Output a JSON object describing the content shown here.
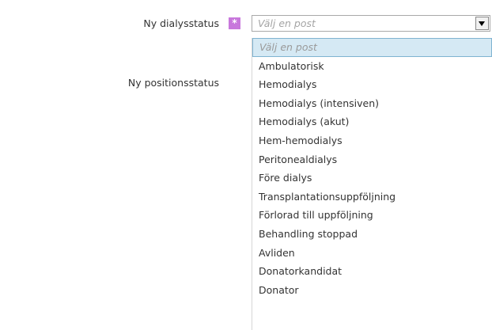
{
  "form": {
    "dialysis_status_label": "Ny dialysstatus",
    "position_status_label": "Ny positionsstatus",
    "required_marker": "*"
  },
  "dropdown": {
    "placeholder": "Välj en post",
    "selected_value": "Välj en post",
    "options": [
      "Välj en post",
      "Ambulatorisk",
      "Hemodialys",
      "Hemodialys (intensiven)",
      "Hemodialys (akut)",
      "Hem-hemodialys",
      "Peritonealdialys",
      "Före dialys",
      "Transplantationsuppföljning",
      "Förlorad till uppföljning",
      "Behandling stoppad",
      "Avliden",
      "Donatorkandidat",
      "Donator"
    ]
  },
  "colors": {
    "required_marker": "#c878dc",
    "highlight_background": "#d5e9f4",
    "highlight_border": "#7fb3d1"
  },
  "icons": {
    "required": "asterisk-icon",
    "dropdown": "dropdown-arrow-icon"
  }
}
